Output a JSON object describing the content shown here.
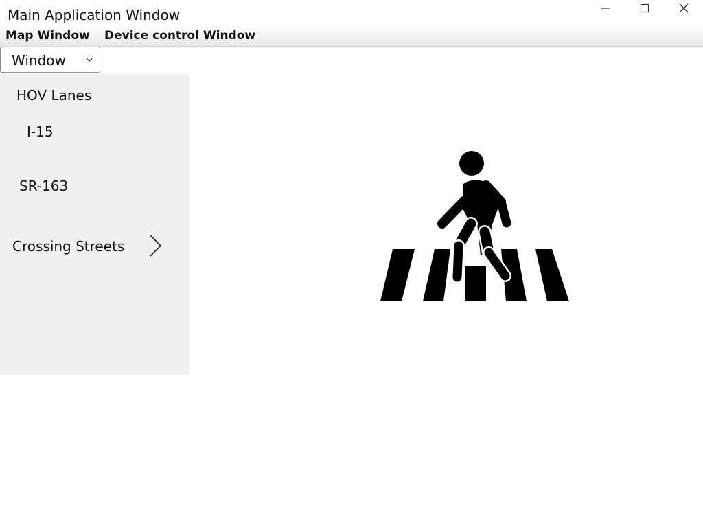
{
  "window": {
    "title": "Main Application Window",
    "controls": {
      "minimize_icon": "minimize-icon",
      "maximize_icon": "maximize-icon",
      "close_icon": "close-icon"
    }
  },
  "menubar": {
    "items": [
      {
        "label": "Map Window"
      },
      {
        "label": "Device control Window"
      }
    ]
  },
  "dropdown": {
    "selected": "Window",
    "icon": "chevron-down-icon"
  },
  "sidebar": {
    "header": "HOV Lanes",
    "items": [
      {
        "label": "I-15"
      },
      {
        "label": "SR-163"
      },
      {
        "label": "Crossing Streets",
        "icon": "chevron-right-icon"
      }
    ]
  },
  "content": {
    "image_icon": "pedestrian-crosswalk-icon"
  },
  "colors": {
    "sidebar_bg": "#f0f0f0",
    "window_bg": "#ffffff",
    "text": "#111111",
    "icon": "#000000"
  }
}
